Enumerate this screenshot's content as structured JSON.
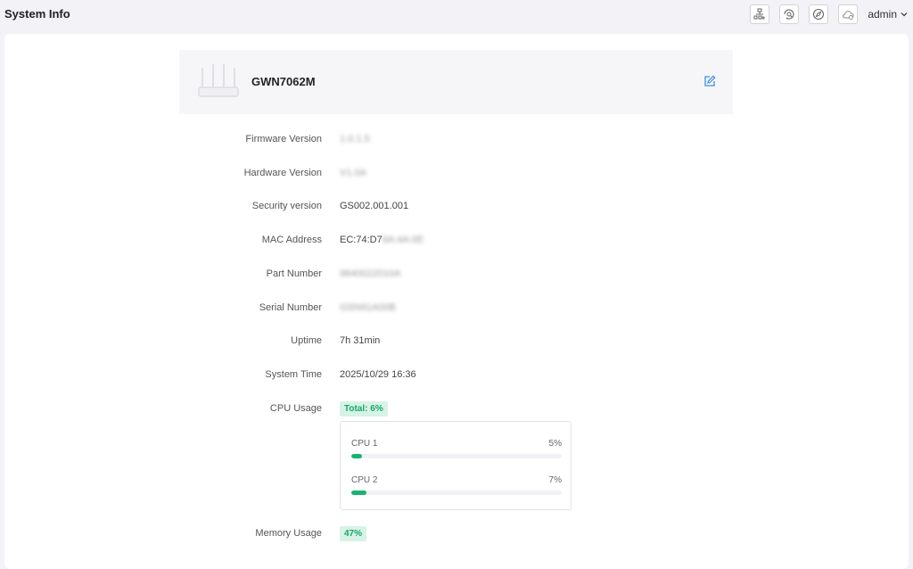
{
  "page": {
    "title": "System Info"
  },
  "topbar": {
    "icons": [
      "topology-icon",
      "diagnostic-icon",
      "compass-icon",
      "cloud-icon"
    ],
    "user": "admin"
  },
  "device": {
    "name": "GWN7062M"
  },
  "info": [
    {
      "label": "Firmware Version",
      "value": "1.0.1.5",
      "blurred": true
    },
    {
      "label": "Hardware Version",
      "value": "V1.0A",
      "blurred": true
    },
    {
      "label": "Security version",
      "value": "GS002.001.001",
      "blurred": false
    },
    {
      "label": "MAC Address",
      "value": "EC:74:D7",
      "value_blurred_tail": "6A:4A:0E"
    },
    {
      "label": "Part Number",
      "value": "9640022010A",
      "blurred": true
    },
    {
      "label": "Serial Number",
      "value": "GSN91A00B",
      "blurred": true
    },
    {
      "label": "Uptime",
      "value": "7h 31min",
      "blurred": false
    },
    {
      "label": "System Time",
      "value": "2025/10/29 16:36",
      "blurred": false
    }
  ],
  "cpu": {
    "label": "CPU Usage",
    "total": "Total: 6%",
    "cores": [
      {
        "name": "CPU 1",
        "percent_label": "5%",
        "percent": 5
      },
      {
        "name": "CPU 2",
        "percent_label": "7%",
        "percent": 7
      }
    ]
  },
  "memory": {
    "label": "Memory Usage",
    "value": "47%"
  },
  "colors": {
    "accent": "#16b372",
    "badge_bg": "#d6f3e6",
    "edit_icon": "#3a8ee6"
  }
}
